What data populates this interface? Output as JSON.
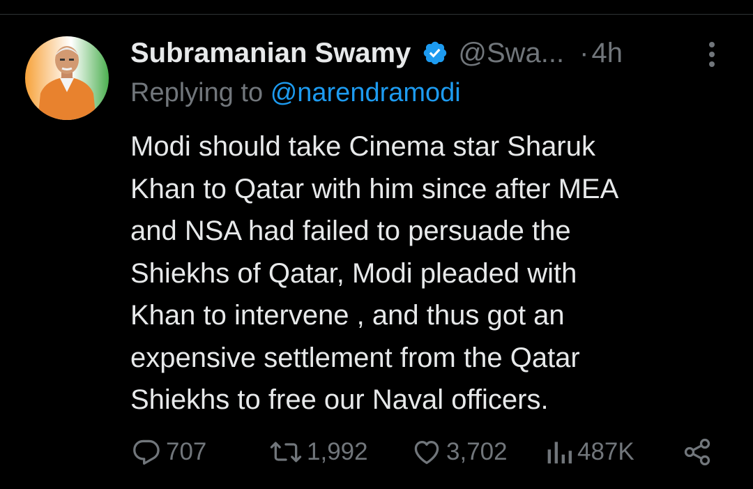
{
  "tweet": {
    "author_name": "Subramanian Swamy",
    "handle": "@Swa...",
    "separator": "·",
    "time": "4h",
    "reply_prefix": "Replying to",
    "reply_to": "@narendramodi",
    "text_lines": [
      "Modi should take Cinema star Sharuk",
      "Khan to Qatar with him since after MEA",
      "and NSA had failed to persuade the",
      "Shiekhs of Qatar, Modi pleaded with",
      "Khan to intervene , and thus got an",
      "expensive settlement from the Qatar",
      "Shiekhs to free our Naval officers."
    ]
  },
  "actions": {
    "replies": "707",
    "reposts": "1,992",
    "likes": "3,702",
    "views": "487K"
  },
  "icons": {
    "verified": "verified-badge-icon",
    "more": "more-options-icon",
    "reply": "reply-icon",
    "repost": "repost-icon",
    "like": "heart-icon",
    "views": "views-icon",
    "share": "share-icon"
  },
  "colors": {
    "background": "#000000",
    "text": "#e7e9ea",
    "muted": "#71767b",
    "link": "#1d9bf0"
  }
}
